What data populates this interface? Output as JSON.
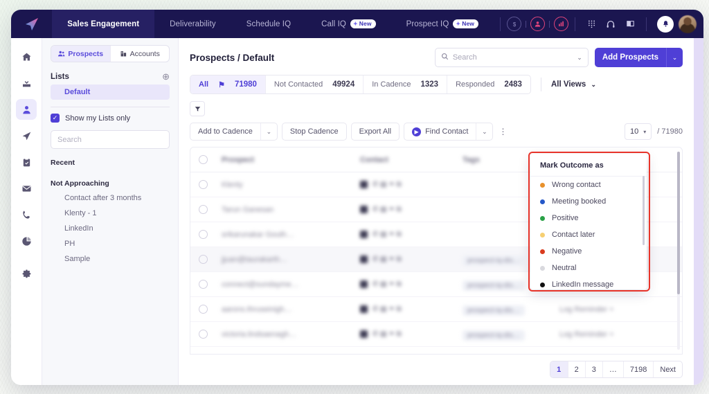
{
  "topnav": {
    "logo_icon": "klenty-paper-plane-logo",
    "tabs": [
      {
        "label": "Sales Engagement",
        "active": true,
        "badge": ""
      },
      {
        "label": "Deliverability",
        "active": false,
        "badge": ""
      },
      {
        "label": "Schedule IQ",
        "active": false,
        "badge": ""
      },
      {
        "label": "Call IQ",
        "active": false,
        "badge": "New"
      },
      {
        "label": "Prospect IQ",
        "active": false,
        "badge": "New"
      }
    ],
    "badge_spark": "✦",
    "actions": [
      {
        "icon": "dollar-circle-icon",
        "glyph": "$",
        "style": "muted"
      },
      {
        "icon": "user-circle-icon",
        "glyph": "♟",
        "style": "pink"
      },
      {
        "icon": "analytics-circle-icon",
        "glyph": "ὌA",
        "style": "pink"
      }
    ],
    "plain_icons": [
      {
        "icon": "dialpad-icon",
        "glyph": "⁙"
      },
      {
        "icon": "headset-icon",
        "glyph": "⌢"
      },
      {
        "icon": "book-icon",
        "glyph": "Ὅ6"
      }
    ],
    "bell_icon": "notification-bell-icon",
    "avatar": "user-avatar"
  },
  "rail": {
    "items": [
      {
        "icon": "home-icon",
        "active": false
      },
      {
        "icon": "inbox-icon",
        "active": false
      },
      {
        "icon": "prospects-icon",
        "active": true
      },
      {
        "icon": "cadence-send-icon",
        "active": false
      },
      {
        "icon": "tasks-clipboard-icon",
        "active": false
      },
      {
        "icon": "email-icon",
        "active": false
      },
      {
        "icon": "calls-phone-icon",
        "active": false
      },
      {
        "icon": "reports-pie-icon",
        "active": false
      },
      {
        "icon": "settings-gear-icon",
        "active": false
      }
    ]
  },
  "lists_panel": {
    "segments": [
      {
        "label": "Prospects",
        "icon": "prospects-icon",
        "active": true
      },
      {
        "label": "Accounts",
        "icon": "accounts-building-icon",
        "active": false
      }
    ],
    "lists_title": "Lists",
    "add_icon": "add-list-icon",
    "default_list": "Default",
    "show_my_lists_label": "Show my Lists only",
    "show_my_lists_checked": true,
    "search_placeholder": "Search",
    "search_value": "",
    "groups": [
      {
        "title": "Recent",
        "items": []
      },
      {
        "title": "Not Approaching",
        "items": [
          "Contact after 3 months",
          "Klenty - 1",
          "LinkedIn",
          "PH",
          "Sample"
        ]
      }
    ]
  },
  "header": {
    "breadcrumb": "Prospects / Default",
    "search_placeholder": "Search",
    "search_value": "",
    "search_icon": "search-icon",
    "search_caret": "⌄",
    "add_prospects_label": "Add Prospects",
    "add_prospects_caret": "⌄"
  },
  "stats": {
    "items": [
      {
        "label": "All",
        "value": "71980",
        "active": true,
        "pin": "⚑"
      },
      {
        "label": "Not Contacted",
        "value": "49924",
        "active": false,
        "pin": ""
      },
      {
        "label": "In Cadence",
        "value": "1323",
        "active": false,
        "pin": ""
      },
      {
        "label": "Responded",
        "value": "2483",
        "active": false,
        "pin": ""
      }
    ],
    "all_views_label": "All Views",
    "all_views_caret": "⌄"
  },
  "toolbar": {
    "filter_icon": "filter-funnel-icon",
    "add_to_cadence_label": "Add to Cadence",
    "stop_cadence_label": "Stop Cadence",
    "export_all_label": "Export All",
    "find_contact_label": "Find Contact",
    "find_contact_icon": "prospect-iq-icon",
    "caret": "⌄",
    "kebab_icon": "more-options-icon",
    "kebab_glyph": "⋮",
    "per_page_value": "10",
    "per_page_caret": "▾",
    "total_label": "/ 71980"
  },
  "table": {
    "columns": [
      "Prospect",
      "Contact",
      "Tags",
      ""
    ],
    "rows": [
      {
        "prospect": "Klenty",
        "tag": "",
        "extra": "",
        "hover": false
      },
      {
        "prospect": "Tarun Ganesan",
        "tag": "",
        "extra": "",
        "hover": false
      },
      {
        "prospect": "srikarunakar Gouth…",
        "tag": "",
        "extra": "",
        "hover": false
      },
      {
        "prospect": "jjuan@taurakarth…",
        "tag": "prospect-iq-dis…",
        "extra": "Log Reminder +",
        "hover": true
      },
      {
        "prospect": "connect@sundayme…",
        "tag": "prospect-iq-dis…",
        "extra": "Log Reminder +",
        "hover": false
      },
      {
        "prospect": "aarons.thruseinigh…",
        "tag": "prospect-iq-dis…",
        "extra": "Log Reminder +",
        "hover": false
      },
      {
        "prospect": "victoria.lindsaenagh…",
        "tag": "prospect-iq-dis…",
        "extra": "Log Reminder +",
        "hover": false
      }
    ],
    "row_icons": [
      "email-icon",
      "phone-icon",
      "note-icon",
      "tag-icon",
      "link-icon"
    ]
  },
  "outcome_menu": {
    "title": "Mark Outcome as",
    "items": [
      {
        "label": "Wrong contact",
        "color": "#e8912c"
      },
      {
        "label": "Meeting booked",
        "color": "#2558c8"
      },
      {
        "label": "Positive",
        "color": "#2aa147"
      },
      {
        "label": "Contact later",
        "color": "#f6cf72"
      },
      {
        "label": "Negative",
        "color": "#d93b1e"
      },
      {
        "label": "Neutral",
        "color": "#d9d9de"
      },
      {
        "label": "LinkedIn message",
        "color": "#111111"
      }
    ],
    "highlight_color": "#e8342a"
  },
  "pagination": {
    "pages": [
      "1",
      "2",
      "3",
      "…",
      "7198",
      "Next"
    ],
    "active": "1"
  },
  "colors": {
    "nav_bg": "#1b1650",
    "nav_active": "#262063",
    "accent": "#4f3fd6",
    "accent_light": "#eceafc",
    "highlight_red": "#e8342a",
    "panel_bg": "#f7f8fb",
    "right_strip": "#e3dcf7"
  }
}
